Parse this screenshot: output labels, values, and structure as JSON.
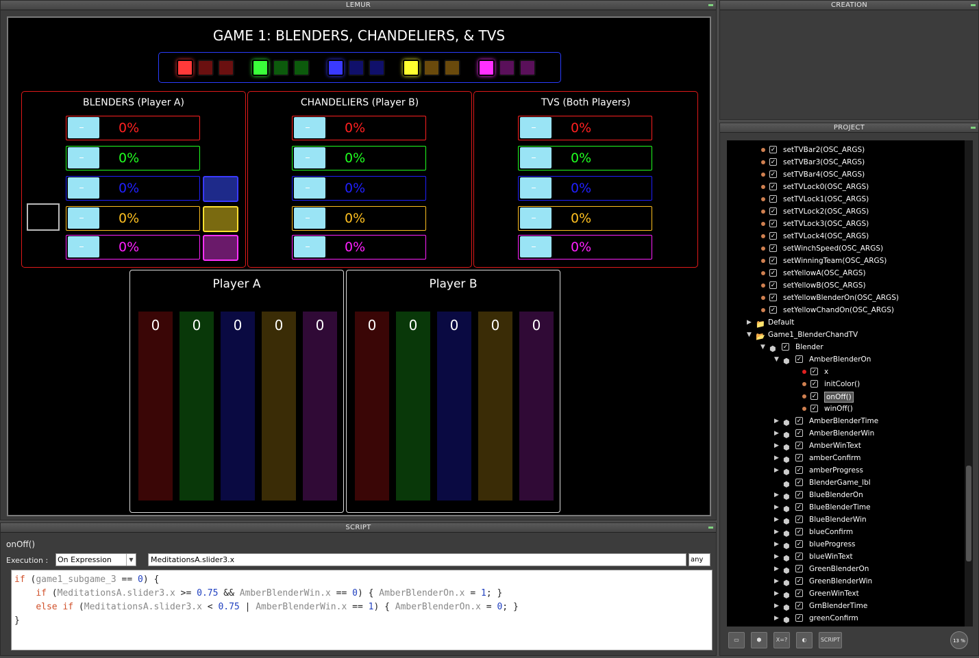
{
  "panels": {
    "lemur": "LEMUR",
    "creation": "CREATION",
    "project": "PROJECT",
    "script": "SCRIPT"
  },
  "game_title": "GAME 1: BLENDERS, CHANDELIERS, & TVS",
  "team_squares": [
    {
      "team": "red",
      "colors": [
        "#ff3a3a",
        "#6a1010",
        "#6a1010"
      ]
    },
    {
      "team": "green",
      "colors": [
        "#3aff3a",
        "#0c5a0c",
        "#0c5a0c"
      ]
    },
    {
      "team": "blue",
      "colors": [
        "#3a3aff",
        "#10106a",
        "#10106a"
      ]
    },
    {
      "team": "yellow",
      "colors": [
        "#ffff30",
        "#6a4a0c",
        "#6a4a0c"
      ]
    },
    {
      "team": "magenta",
      "colors": [
        "#ff30ff",
        "#5a105a",
        "#5a105a"
      ]
    }
  ],
  "groups": [
    {
      "title": "BLENDERS (Player A)",
      "bars": [
        {
          "color": "#ff2020",
          "text": "0%",
          "progress": 0
        },
        {
          "color": "#20ff20",
          "text": "0%",
          "progress": 0
        },
        {
          "color": "#2020ff",
          "text": "0%",
          "progress": 0
        },
        {
          "color": "#ffc020",
          "text": "0%",
          "progress": 0
        },
        {
          "color": "#ff20ff",
          "text": "0%",
          "progress": 0
        }
      ]
    },
    {
      "title": "CHANDELIERS (Player B)",
      "bars": [
        {
          "color": "#ff2020",
          "text": "0%",
          "progress": 0
        },
        {
          "color": "#20ff20",
          "text": "0%",
          "progress": 0
        },
        {
          "color": "#2020ff",
          "text": "0%",
          "progress": 0
        },
        {
          "color": "#ffc020",
          "text": "0%",
          "progress": 0
        },
        {
          "color": "#ff20ff",
          "text": "0%",
          "progress": 0
        }
      ]
    },
    {
      "title": "TVS (Both Players)",
      "bars": [
        {
          "color": "#ff2020",
          "text": "0%",
          "progress": 0
        },
        {
          "color": "#20ff20",
          "text": "0%",
          "progress": 0
        },
        {
          "color": "#2020ff",
          "text": "0%",
          "progress": 0
        },
        {
          "color": "#ffc020",
          "text": "0%",
          "progress": 0
        },
        {
          "color": "#ff20ff",
          "text": "0%",
          "progress": 0
        }
      ]
    }
  ],
  "players": [
    {
      "title": "Player A",
      "values": [
        "0",
        "0",
        "0",
        "0",
        "0"
      ]
    },
    {
      "title": "Player B",
      "values": [
        "0",
        "0",
        "0",
        "0",
        "0"
      ]
    }
  ],
  "column_colors": [
    "#3a0606",
    "#093809",
    "#0a0a42",
    "#3a2c06",
    "#300a36"
  ],
  "project_tree": [
    {
      "text": "setTVBar2(OSC_ARGS)",
      "kind": "script"
    },
    {
      "text": "setTVBar3(OSC_ARGS)",
      "kind": "script"
    },
    {
      "text": "setTVBar4(OSC_ARGS)",
      "kind": "script"
    },
    {
      "text": "setTVLock0(OSC_ARGS)",
      "kind": "script"
    },
    {
      "text": "setTVLock1(OSC_ARGS)",
      "kind": "script"
    },
    {
      "text": "setTVLock2(OSC_ARGS)",
      "kind": "script"
    },
    {
      "text": "setTVLock3(OSC_ARGS)",
      "kind": "script"
    },
    {
      "text": "setTVLock4(OSC_ARGS)",
      "kind": "script"
    },
    {
      "text": "setWinchSpeed(OSC_ARGS)",
      "kind": "script"
    },
    {
      "text": "setWinningTeam(OSC_ARGS)",
      "kind": "script"
    },
    {
      "text": "setYellowA(OSC_ARGS)",
      "kind": "script"
    },
    {
      "text": "setYellowB(OSC_ARGS)",
      "kind": "script"
    },
    {
      "text": "setYellowBlenderOn(OSC_ARGS)",
      "kind": "script"
    },
    {
      "text": "setYellowChandOn(OSC_ARGS)",
      "kind": "script"
    },
    {
      "text": "Default",
      "kind": "folder-collapsed"
    },
    {
      "text": "Game1_BlenderChandTV",
      "kind": "folder-expanded"
    },
    {
      "text": "Blender",
      "kind": "object-expanded"
    },
    {
      "text": "AmberBlenderOn",
      "kind": "object-expanded-l2"
    },
    {
      "text": "x",
      "kind": "var"
    },
    {
      "text": "initColor()",
      "kind": "script-l3"
    },
    {
      "text": "onOff()",
      "kind": "script-l3-selected"
    },
    {
      "text": "winOff()",
      "kind": "script-l3"
    },
    {
      "text": "AmberBlenderTime",
      "kind": "object-l2"
    },
    {
      "text": "AmberBlenderWin",
      "kind": "object-l2"
    },
    {
      "text": "AmberWinText",
      "kind": "object-l2"
    },
    {
      "text": "amberConfirm",
      "kind": "object-l2"
    },
    {
      "text": "amberProgress",
      "kind": "object-l2"
    },
    {
      "text": "BlenderGame_lbl",
      "kind": "object-l2-leaf"
    },
    {
      "text": "BlueBlenderOn",
      "kind": "object-l2"
    },
    {
      "text": "BlueBlenderTime",
      "kind": "object-l2"
    },
    {
      "text": "BlueBlenderWin",
      "kind": "object-l2"
    },
    {
      "text": "blueConfirm",
      "kind": "object-l2"
    },
    {
      "text": "blueProgress",
      "kind": "object-l2"
    },
    {
      "text": "blueWinText",
      "kind": "object-l2"
    },
    {
      "text": "GreenBlenderOn",
      "kind": "object-l2"
    },
    {
      "text": "GreenBlenderWin",
      "kind": "object-l2"
    },
    {
      "text": "GreenWinText",
      "kind": "object-l2"
    },
    {
      "text": "GrnBlenderTime",
      "kind": "object-l2"
    },
    {
      "text": "greenConfirm",
      "kind": "object-l2"
    }
  ],
  "toolbar": {
    "script_btn": "SCRIPT",
    "expr_btn": "X=?",
    "memory": "13 %"
  },
  "script": {
    "name": "onOff()",
    "execution_label": "Execution :",
    "execution_value": "On Expression",
    "expression": "MeditationsA.slider3.x",
    "any": "any",
    "code_lines": [
      "if (game1_subgame_3 == 0) {",
      "    if (MeditationsA.slider3.x >= 0.75 && AmberBlenderWin.x == 0) { AmberBlenderOn.x = 1; }",
      "    else if (MeditationsA.slider3.x < 0.75 | AmberBlenderWin.x == 1) { AmberBlenderOn.x = 0; }",
      "}"
    ]
  }
}
